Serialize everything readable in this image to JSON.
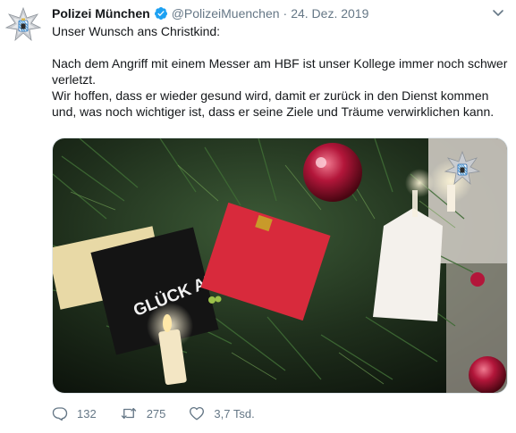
{
  "author": {
    "name": "Polizei München",
    "handle": "@PolizeiMuenchen",
    "separator": "·",
    "date": "24. Dez. 2019",
    "verified": true
  },
  "tweet": {
    "lines": [
      "Unser Wunsch ans Christkind:",
      "",
      "Nach dem Angriff mit einem Messer am HBF ist unser Kollege immer noch schwer",
      "verletzt.",
      "Wir hoffen, dass er wieder gesund wird, damit er zurück in den Dienst kommen",
      "und, was noch wichtiger ist, dass er seine Ziele und Träume verwirklichen kann."
    ]
  },
  "image": {
    "card_text": "GLÜCK AUF!"
  },
  "actions": {
    "replies": "132",
    "retweets": "275",
    "likes": "3,7 Tsd."
  },
  "colors": {
    "text": "#14171a",
    "secondary": "#657786",
    "verified": "#1da1f2",
    "border": "#e1e8ed"
  },
  "icons": {
    "avatar": "police-star-emblem",
    "verified": "verified-badge-icon",
    "menu": "chevron-down-icon",
    "reply": "reply-icon",
    "retweet": "retweet-icon",
    "like": "heart-icon"
  }
}
